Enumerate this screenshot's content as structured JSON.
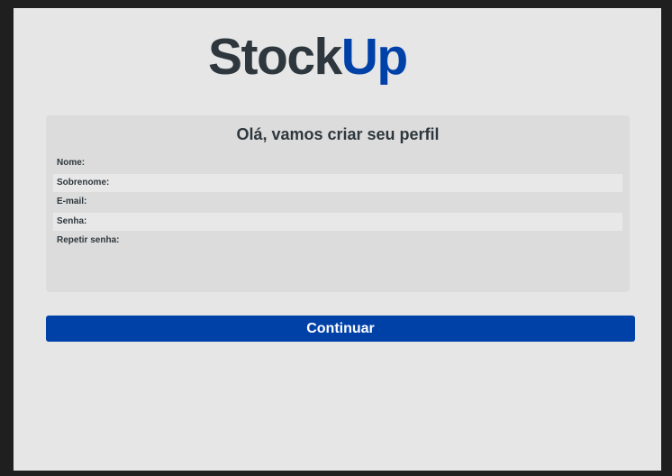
{
  "logo": {
    "part1": "Stock",
    "part2": "Up"
  },
  "form": {
    "title": "Olá, vamos criar seu perfil",
    "fields": [
      {
        "label": "Nome:"
      },
      {
        "label": "Sobrenome:"
      },
      {
        "label": "E-mail:"
      },
      {
        "label": "Senha:"
      },
      {
        "label": "Repetir senha:"
      }
    ]
  },
  "actions": {
    "continue_label": "Continuar"
  },
  "colors": {
    "brand_dark": "#2e373d",
    "brand_blue": "#0041a8",
    "background": "#e6e6e6",
    "card": "#dcdcdc"
  }
}
